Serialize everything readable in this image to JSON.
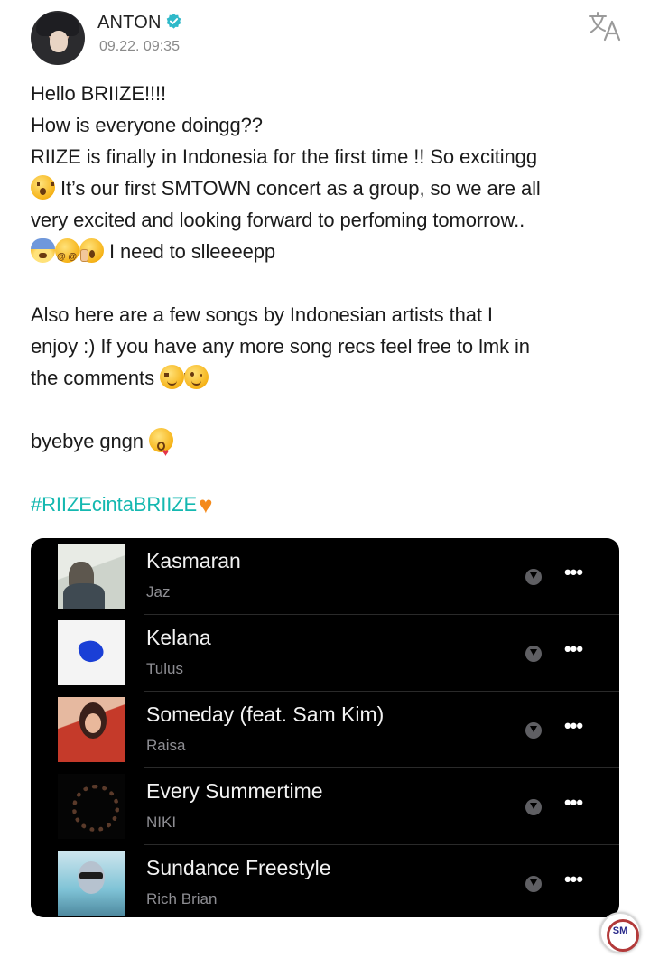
{
  "post": {
    "author": "ANTON",
    "timestamp": "09.22. 09:35",
    "lines": [
      "Hello BRIIZE!!!!",
      "How is everyone doingg??",
      "RIIZE is finally in Indonesia for the first time !! So excitingg",
      "It’s our first SMTOWN concert as a group, so we are all",
      "very excited and looking forward to perfoming tomorrow..",
      "I need to slleeeepp",
      "Also here are a few songs by Indonesian artists that I",
      "enjoy :) If you have any more song recs feel free to lmk in",
      "the comments",
      "byebye gngn"
    ],
    "hashtag": "#RIIZEcintaBRIIZE",
    "icons": {
      "verified": "verified-badge-icon",
      "translate": "translate-icon"
    }
  },
  "playlist": {
    "tracks": [
      {
        "title": "Kasmaran",
        "artist": "Jaz"
      },
      {
        "title": "Kelana",
        "artist": "Tulus"
      },
      {
        "title": "Someday (feat. Sam Kim)",
        "artist": "Raisa"
      },
      {
        "title": "Every Summertime",
        "artist": "NIKI"
      },
      {
        "title": "Sundance Freestyle",
        "artist": "Rich Brian"
      }
    ],
    "more_label": "•••"
  },
  "colors": {
    "accent_hashtag": "#14b8b0",
    "verified": "#2fb9c9",
    "heart": "#f48a1b",
    "playlist_bg": "#000000"
  }
}
